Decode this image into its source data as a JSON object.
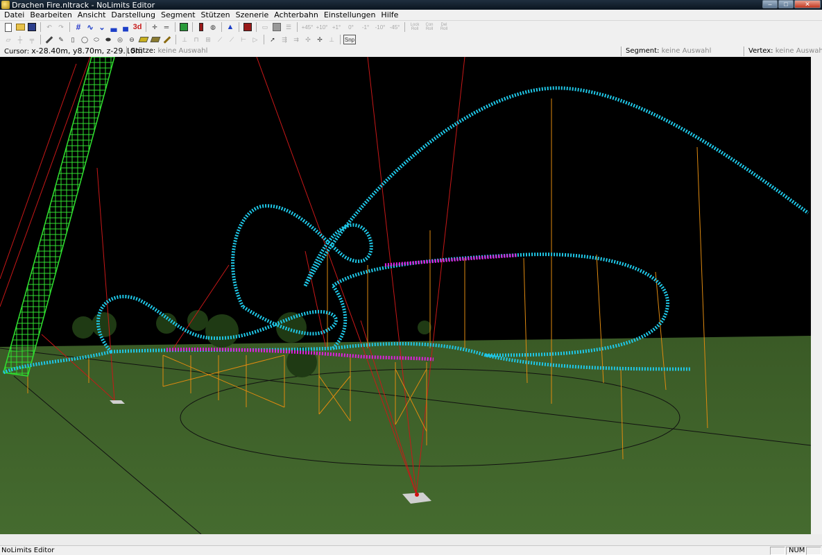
{
  "window": {
    "title": "Drachen Fire.nltrack - NoLimits Editor",
    "minimize": "–",
    "maximize": "□",
    "close": "✕"
  },
  "menu": [
    {
      "label": "Datei"
    },
    {
      "label": "Bearbeiten"
    },
    {
      "label": "Ansicht"
    },
    {
      "label": "Darstellung"
    },
    {
      "label": "Segment"
    },
    {
      "label": "Stützen"
    },
    {
      "label": "Szenerie"
    },
    {
      "label": "Achterbahn"
    },
    {
      "label": "Einstellungen"
    },
    {
      "label": "Hilfe"
    }
  ],
  "toolbar1": {
    "icons": [
      "new-file-icon",
      "open-folder-icon",
      "save-icon",
      "undo-icon",
      "redo-icon",
      "grid-icon",
      "wave-track-icon",
      "valley-track-icon",
      "train-icon",
      "train-alt-icon",
      "3d-view-icon",
      "crosshair-icon",
      "flat-segment-icon",
      "green-block-icon",
      "signal-icon",
      "globe-icon",
      "warning-icon",
      "record-icon",
      "window-icon",
      "gray-box-icon",
      "adjust-icon"
    ],
    "label_3d": "3d",
    "roll_buttons": [
      "+45°",
      "+10°",
      "+1°",
      "0°",
      "-1°",
      "-10°",
      "-45°"
    ],
    "lock_roll": "Lock Roll",
    "con_roll": "Con Roll",
    "del_roll": "Del Roll"
  },
  "toolbar2": {
    "icons": [
      "eraser-icon",
      "split-icon",
      "support-icon",
      "pencil-icon",
      "pen-icon",
      "pillar-icon",
      "ring-icon",
      "cylinder-icon",
      "cylinder-alt-icon",
      "barrel-icon",
      "disk-icon",
      "yellow-block-icon",
      "wood-icon",
      "footer-icon",
      "support-a-icon",
      "support-b-icon",
      "support-c-icon",
      "support-d-icon",
      "support-e-icon",
      "support-f-icon",
      "pointer-icon",
      "add-node-icon",
      "add-branch-icon",
      "add-vertex-icon",
      "add-multi-icon",
      "anchor-icon"
    ],
    "snap_label": "Snp"
  },
  "status_row": {
    "cursor_label": "Cursor:",
    "cursor_value": "x-28.40m, y8.70m, z-29.10m",
    "support_label": "Stütze:",
    "support_value": "keine Auswahl",
    "segment_label": "Segment:",
    "segment_value": "keine Auswahl",
    "vertex_label": "Vertex:",
    "vertex_value": "keine Auswahl"
  },
  "statusbar": {
    "text": "NoLimits Editor",
    "num": "NUM"
  },
  "colors": {
    "track": "#1fc8e8",
    "selected_track": "#e020e0",
    "lift_hill": "#30e030",
    "supports": "#e08a10",
    "guide_lines": "#c81818",
    "ground": "#3c5a28",
    "sky": "#000000"
  }
}
